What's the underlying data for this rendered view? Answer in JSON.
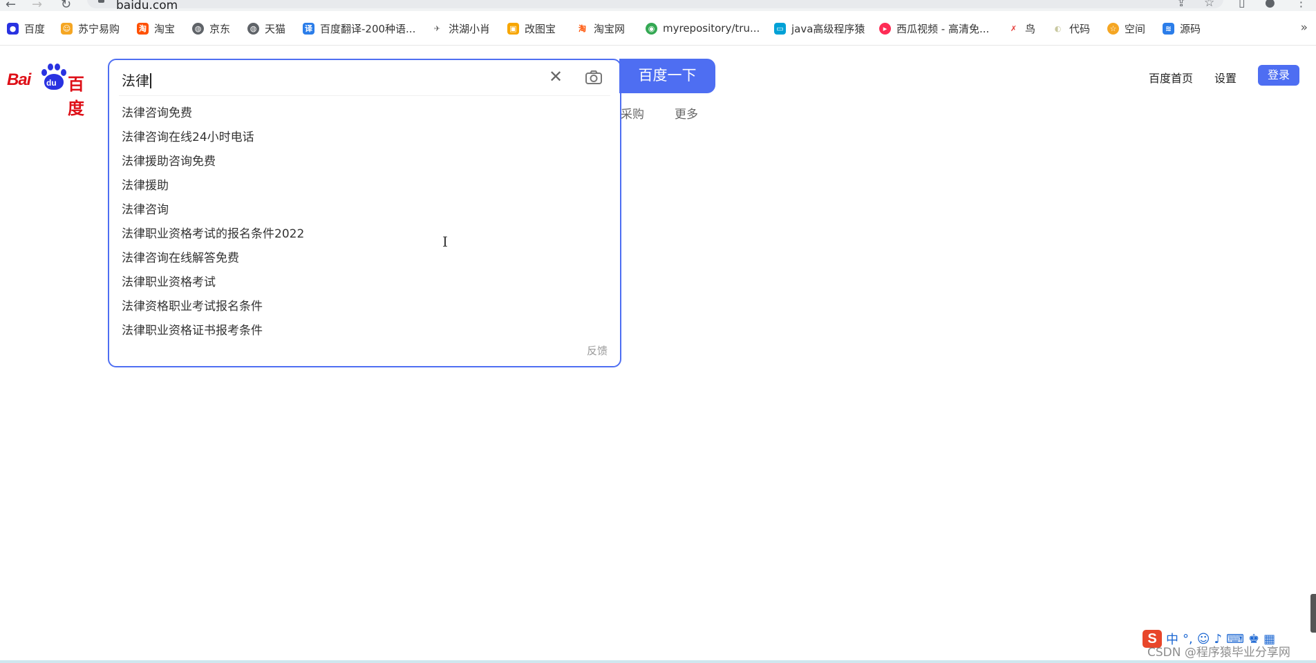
{
  "browser": {
    "url": "baidu.com"
  },
  "bookmarks": [
    {
      "label": "百度",
      "icon": "baidu-paw-icon",
      "color": "#2932e1"
    },
    {
      "label": "苏宁易购",
      "icon": "suning-icon",
      "color": "#f5a623"
    },
    {
      "label": "淘宝",
      "icon": "taobao-icon",
      "color": "#ff5000"
    },
    {
      "label": "京东",
      "icon": "globe-icon",
      "color": "#5f6368"
    },
    {
      "label": "天猫",
      "icon": "globe-icon",
      "color": "#5f6368"
    },
    {
      "label": "百度翻译-200种语...",
      "icon": "translate-icon",
      "color": "#2b7de9"
    },
    {
      "label": "洪湖小肖",
      "icon": "bird-icon",
      "color": "#666666"
    },
    {
      "label": "改图宝",
      "icon": "image-icon",
      "color": "#f7a600"
    },
    {
      "label": "淘宝网",
      "icon": "taobao-icon",
      "color": "#ff5000"
    },
    {
      "label": "myrepository/tru...",
      "icon": "chrome-icon",
      "color": "#34a853"
    },
    {
      "label": "java高级程序猿",
      "icon": "bilibili-icon",
      "color": "#00a1d6"
    },
    {
      "label": "西瓜视频 - 高清免...",
      "icon": "play-icon",
      "color": "#fe2c55"
    },
    {
      "label": "鸟",
      "icon": "bird-icon",
      "color": "#e53935"
    },
    {
      "label": "代码",
      "icon": "moon-icon",
      "color": "#c8c8a0"
    },
    {
      "label": "空间",
      "icon": "qzone-icon",
      "color": "#f5a623"
    },
    {
      "label": "源码",
      "icon": "fish-icon",
      "color": "#2b7de9"
    }
  ],
  "logo": {
    "latin": "Bai",
    "paw_text": "du",
    "chinese": "百度"
  },
  "search": {
    "query": "法律",
    "button_label": "百度一下",
    "suggestions": [
      "法律咨询免费",
      "法律咨询在线24小时电话",
      "法律援助咨询免费",
      "法律援助",
      "法律咨询",
      "法律职业资格考试的报名条件2022",
      "法律咨询在线解答免费",
      "法律职业资格考试",
      "法律资格职业考试报名条件",
      "法律职业资格证书报考条件"
    ],
    "feedback_label": "反馈"
  },
  "tabs_partial": {
    "purchase": "采购",
    "more": "更多"
  },
  "header": {
    "home_link": "百度首页",
    "settings_link": "设置",
    "login_button": "登录"
  },
  "ime": {
    "logo": "S",
    "mode": "中"
  },
  "watermark": "CSDN @程序猿毕业分享网",
  "colors": {
    "brand_blue": "#4e6ef2",
    "brand_red": "#de0f17"
  }
}
